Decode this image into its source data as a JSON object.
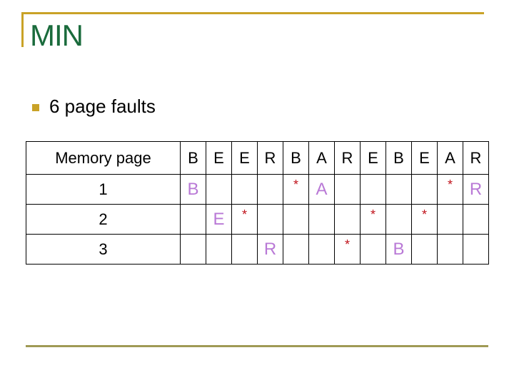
{
  "slide": {
    "title": "MIN",
    "bullets": [
      "6 page faults"
    ],
    "accent_color": "#c9a227",
    "title_color": "#1a6b3c",
    "page_color": "#b979d6",
    "hit_color": "#c0141c"
  },
  "table": {
    "header_label": "Memory page",
    "references": [
      "B",
      "E",
      "E",
      "R",
      "B",
      "A",
      "R",
      "E",
      "B",
      "E",
      "A",
      "R"
    ],
    "rows": [
      {
        "label": "1",
        "cells": [
          "B",
          "",
          "",
          "",
          "*",
          "A",
          "",
          "",
          "",
          "",
          "*",
          "R"
        ]
      },
      {
        "label": "2",
        "cells": [
          "",
          "E",
          "*",
          "",
          "",
          "",
          "",
          "*",
          "",
          "*",
          "",
          ""
        ]
      },
      {
        "label": "3",
        "cells": [
          "",
          "",
          "",
          "R",
          "",
          "",
          "*",
          "",
          "B",
          "",
          "",
          ""
        ]
      }
    ]
  }
}
